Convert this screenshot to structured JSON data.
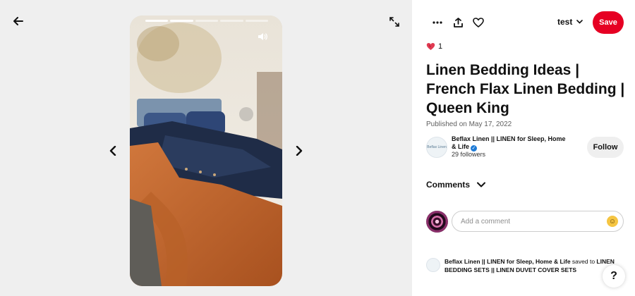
{
  "media": {
    "progress_total": 5,
    "progress_done": 2
  },
  "icons": {
    "back": "arrow-left-icon",
    "expand": "expand-icon",
    "prev": "chevron-left-icon",
    "next": "chevron-right-icon",
    "sound": "speaker-icon",
    "more": "more-icon",
    "share": "share-icon",
    "heart": "heart-icon"
  },
  "header": {
    "board_name": "test",
    "save_label": "Save"
  },
  "reactions": {
    "count": "1"
  },
  "pin": {
    "title": "Linen Bedding Ideas | French Flax Linen Bedding | Queen King",
    "published": "Published on May 17, 2022"
  },
  "creator": {
    "name": "Beflax Linen || LINEN for Sleep, Home & Life",
    "followers": "29 followers",
    "follow_label": "Follow",
    "avatar_text": "Beflax Linen"
  },
  "comments": {
    "heading": "Comments",
    "placeholder": "Add a comment"
  },
  "activity": {
    "actor": "Beflax Linen || LINEN for Sleep, Home & Life",
    "verb": " saved to ",
    "target": "LINEN BEDDING SETS || LINEN DUVET COVER SETS"
  },
  "help": {
    "label": "?"
  },
  "colors": {
    "save_button": "#e60023",
    "left_background": "#efefef",
    "verified": "#1d7ad6"
  }
}
